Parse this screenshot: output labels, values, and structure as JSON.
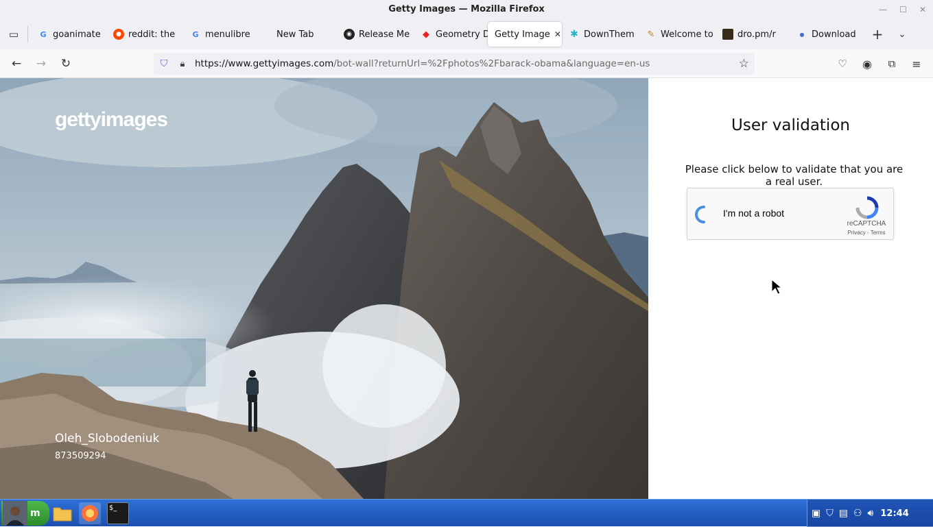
{
  "window": {
    "title": "Getty Images — Mozilla Firefox"
  },
  "tabs": [
    {
      "label": "goanimate",
      "icon": "google-icon"
    },
    {
      "label": "reddit: the",
      "icon": "reddit-icon"
    },
    {
      "label": "menulibre",
      "icon": "google-icon"
    },
    {
      "label": "New Tab",
      "icon": ""
    },
    {
      "label": "Release Me",
      "icon": "github-icon"
    },
    {
      "label": "Geometry D",
      "icon": "geometry-icon"
    },
    {
      "label": "Getty Image",
      "icon": "",
      "active": true
    },
    {
      "label": "DownThem",
      "icon": "downthem-icon"
    },
    {
      "label": "Welcome to",
      "icon": "welcome-icon"
    },
    {
      "label": "dro.pm/r",
      "icon": "dropm-icon"
    },
    {
      "label": "Download",
      "icon": "download-dot-icon"
    }
  ],
  "navbar": {
    "url_host": "https://www.gettyimages.com",
    "url_path": "/bot-wall?returnUrl=%2Fphotos%2Fbarack-obama&language=en-us"
  },
  "hero": {
    "logo_text": "gettyimages",
    "photographer": "Oleh_Slobodeniuk",
    "image_id": "873509294"
  },
  "validation": {
    "heading": "User validation",
    "instructions": "Please click below to validate that you are a real user.",
    "checkbox_label": "I'm not a robot",
    "recaptcha_brand": "reCAPTCHA",
    "recaptcha_links": "Privacy - Terms"
  },
  "taskbar": {
    "clock": "12:44"
  },
  "colors": {
    "tab_bg": "#f0f0f4",
    "taskbar_blue": "#2e6fd6",
    "recaptcha_blue": "#4a90e2"
  }
}
